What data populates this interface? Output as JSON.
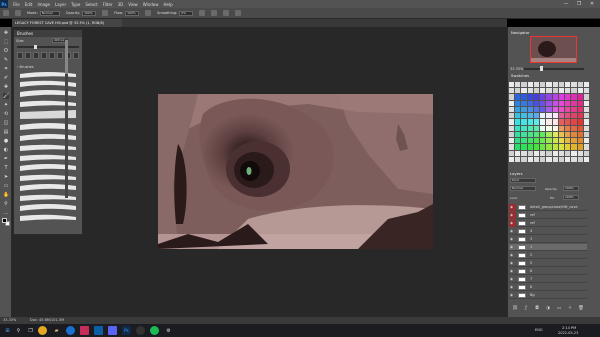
{
  "app": {
    "logo": "Ps",
    "menu": [
      "File",
      "Edit",
      "Image",
      "Layer",
      "Type",
      "Select",
      "Filter",
      "3D",
      "View",
      "Window",
      "Help"
    ],
    "window_controls": [
      "—",
      "❐",
      "✕"
    ]
  },
  "options_bar": {
    "mode_label": "Mode:",
    "mode_value": "Normal",
    "opacity_label": "Opacity:",
    "opacity_value": "100%",
    "flow_label": "Flow:",
    "flow_value": "100%",
    "smoothing_label": "Smoothing:",
    "smoothing_value": "0%"
  },
  "document": {
    "tab_title": "LEGACY FOREST CAVE Hill.psd @ 33.3% (1, RGB/8)",
    "zoom_status": "33.33%",
    "doc_status": "Doc: 45.6M/101.5M"
  },
  "toolbar": {
    "tools": [
      "move-icon",
      "marquee-icon",
      "lasso-icon",
      "quick-select-icon",
      "crop-icon",
      "eyedropper-icon",
      "healing-icon",
      "brush-icon",
      "stamp-icon",
      "history-brush-icon",
      "eraser-icon",
      "gradient-icon",
      "blur-icon",
      "dodge-icon",
      "pen-icon",
      "type-icon",
      "path-select-icon",
      "shape-icon",
      "hand-icon",
      "zoom-icon",
      "more-icon"
    ],
    "glyphs": [
      "✥",
      "⬚",
      "ʘ",
      "✎",
      "⌗",
      "✐",
      "✚",
      "🖌",
      "✦",
      "⟲",
      "◫",
      "▤",
      "●",
      "◐",
      "✒",
      "T",
      "➤",
      "▭",
      "✋",
      "⚲",
      "…"
    ],
    "fg_color": "#000000",
    "bg_color": "#ffffff"
  },
  "brushes_panel": {
    "title": "Brushes",
    "size_label": "Size:",
    "size_value": "400 px",
    "folder_label": "› Brushes",
    "strokes": 19
  },
  "navigator": {
    "title": "Navigator",
    "zoom": "33.33%"
  },
  "swatches": {
    "title": "Swatches"
  },
  "layers": {
    "title": "Layers",
    "kind_label": "Kind",
    "blend_mode": "Normal",
    "opacity_label": "Opacity:",
    "opacity_value": "100%",
    "lock_label": "Lock:",
    "fill_label": "Fill:",
    "fill_value": "100%",
    "rows": [
      {
        "name": "detail_groupclose/Hill_cave",
        "thumb": "#ffffff",
        "selected": false,
        "red": true
      },
      {
        "name": "ref",
        "thumb": "#ffffff",
        "selected": false,
        "red": true
      },
      {
        "name": "ref",
        "thumb": "#ffffff",
        "selected": false,
        "red": true
      },
      {
        "name": "4",
        "thumb": "#ffffff",
        "selected": false,
        "red": false
      },
      {
        "name": "3",
        "thumb": "#ffffff",
        "selected": false,
        "red": false
      },
      {
        "name": "1",
        "thumb": "#ffffff",
        "selected": true,
        "red": false
      },
      {
        "name": "2",
        "thumb": "#ffffff",
        "selected": false,
        "red": false
      },
      {
        "name": "5",
        "thumb": "#ffffff",
        "selected": false,
        "red": false
      },
      {
        "name": "6",
        "thumb": "#ffffff",
        "selected": false,
        "red": false
      },
      {
        "name": "7",
        "thumb": "#ffffff",
        "selected": false,
        "red": false
      },
      {
        "name": "8",
        "thumb": "#ffffff",
        "selected": false,
        "red": false
      },
      {
        "name": "Bg",
        "thumb": "#ffffff",
        "selected": false,
        "red": false
      }
    ],
    "bottom_icons": [
      "link-icon",
      "fx-icon",
      "mask-icon",
      "adjustment-icon",
      "folder-icon",
      "new-layer-icon",
      "trash-icon"
    ]
  },
  "taskbar": {
    "search_placeholder": "Type here to search",
    "apps": [
      "windows-start-icon",
      "chrome-icon",
      "file-explorer-icon",
      "edge-icon",
      "steam-icon",
      "discord-icon",
      "photoshop-icon",
      "obs-icon",
      "spotify-icon",
      "settings-icon"
    ],
    "language": "ENG",
    "time": "2:14 PM",
    "date": "2022-05-23"
  }
}
